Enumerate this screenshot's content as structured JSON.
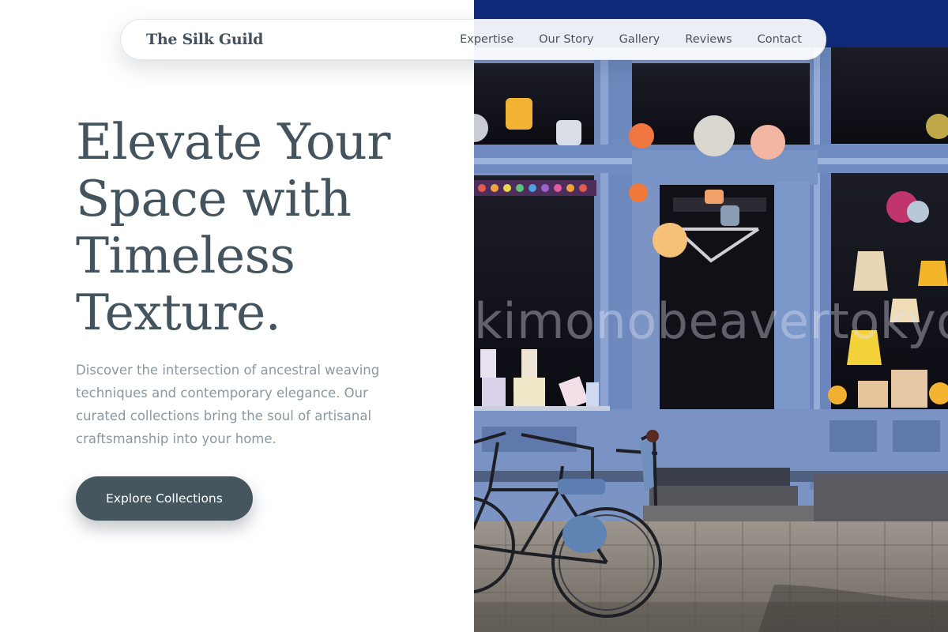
{
  "nav": {
    "brand": "The Silk Guild",
    "links": [
      "Expertise",
      "Our Story",
      "Gallery",
      "Reviews",
      "Contact"
    ]
  },
  "hero": {
    "headline": "Elevate Your Space with Timeless Texture.",
    "lead": "Discover the intersection of ancestral weaving techniques and contemporary elegance. Our curated collections bring the soul of artisanal craftsmanship into your home.",
    "cta_label": "Explore Collections"
  },
  "photo": {
    "watermark": "kimonobeavertokyo",
    "icon": "storefront-image"
  },
  "colors": {
    "text_dark": "#43545f",
    "text_muted": "#8a97a1",
    "button": "#46565f",
    "photo_frame_blue": "#6f8bbf"
  }
}
